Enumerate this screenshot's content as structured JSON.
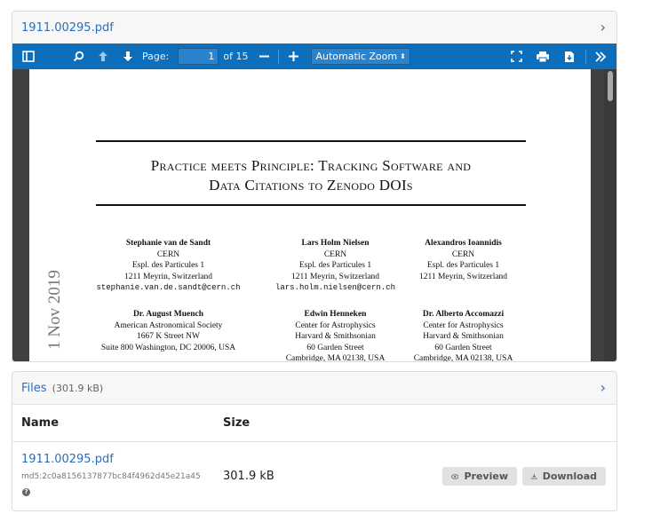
{
  "preview": {
    "filename": "1911.00295.pdf",
    "toolbar": {
      "page_label": "Page:",
      "page_value": "1",
      "page_total": "of 15",
      "zoom": "Automatic Zoom"
    },
    "pdf": {
      "title_line1": "Practice meets Principle: Tracking Software and",
      "title_line2": "Data Citations to Zenodo DOIs",
      "arxiv_stamp": "1 Nov 2019",
      "authors": [
        {
          "name": "Stephanie van de Sandt",
          "lines": [
            "CERN",
            "Espl. des Particules 1",
            "1211 Meyrin, Switzerland"
          ],
          "email": "stephanie.van.de.sandt@cern.ch"
        },
        {
          "name": "Lars Holm Nielsen",
          "lines": [
            "CERN",
            "Espl. des Particules 1",
            "1211 Meyrin, Switzerland"
          ],
          "email": "lars.holm.nielsen@cern.ch"
        },
        {
          "name": "Alexandros Ioannidis",
          "lines": [
            "CERN",
            "Espl. des Particules 1",
            "1211 Meyrin, Switzerland"
          ],
          "email": ""
        },
        {
          "name": "Dr. August Muench",
          "lines": [
            "American Astronomical Society",
            "1667 K Street NW",
            "Suite 800 Washington, DC 20006, USA"
          ],
          "email": ""
        },
        {
          "name": "Edwin Henneken",
          "lines": [
            "Center for Astrophysics",
            "Harvard & Smithsonian",
            "60 Garden Street",
            "Cambridge, MA 02138, USA"
          ],
          "email": ""
        },
        {
          "name": "Dr. Alberto Accomazzi",
          "lines": [
            "Center for Astrophysics",
            "Harvard & Smithsonian",
            "60 Garden Street",
            "Cambridge, MA 02138, USA"
          ],
          "email": ""
        }
      ]
    }
  },
  "files": {
    "title": "Files",
    "total_size": "(301.9 kB)",
    "columns": [
      "Name",
      "Size"
    ],
    "rows": [
      {
        "name": "1911.00295.pdf",
        "md5": "md5:2c0a8156137877bc84f4962d45e21a45",
        "size": "301.9 kB",
        "preview_label": "Preview",
        "download_label": "Download"
      }
    ]
  },
  "colors": {
    "toolbar": "#0d6fbc",
    "link": "#2a6ebb",
    "button": "#e0e1e2"
  }
}
